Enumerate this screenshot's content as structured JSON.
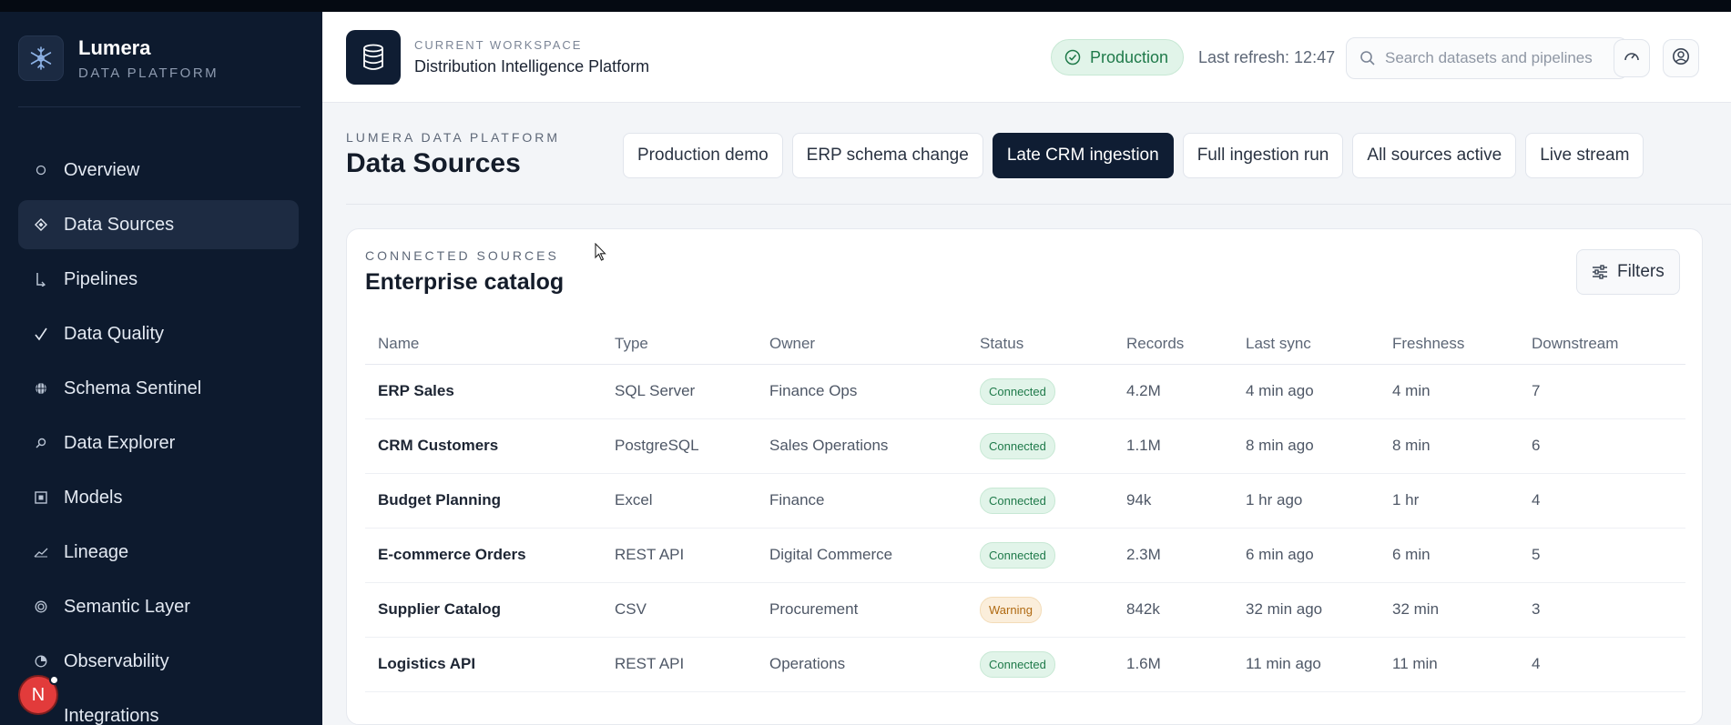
{
  "brand": {
    "name": "Lumera",
    "subtitle": "DATA PLATFORM"
  },
  "sidebar": {
    "items": [
      {
        "label": "Overview",
        "icon": "circle-outline-icon",
        "active": false
      },
      {
        "label": "Data Sources",
        "icon": "diamond-icon",
        "active": true
      },
      {
        "label": "Pipelines",
        "icon": "pipeline-icon",
        "active": false
      },
      {
        "label": "Data Quality",
        "icon": "checkmark-icon",
        "active": false
      },
      {
        "label": "Schema Sentinel",
        "icon": "globe-icon",
        "active": false
      },
      {
        "label": "Data Explorer",
        "icon": "magnifier-icon",
        "active": false
      },
      {
        "label": "Models",
        "icon": "square-icon",
        "active": false
      },
      {
        "label": "Lineage",
        "icon": "lineage-icon",
        "active": false
      },
      {
        "label": "Semantic Layer",
        "icon": "target-icon",
        "active": false
      },
      {
        "label": "Observability",
        "icon": "pie-icon",
        "active": false
      },
      {
        "label": "Integrations",
        "icon": "plug-icon",
        "active": false
      }
    ],
    "avatar_initial": "N"
  },
  "header": {
    "workspace_label": "CURRENT WORKSPACE",
    "workspace_name": "Distribution Intelligence Platform",
    "environment": "Production",
    "last_refresh": "Last refresh: 12:47",
    "search_placeholder": "Search datasets and pipelines"
  },
  "page": {
    "breadcrumb": "LUMERA DATA PLATFORM",
    "title": "Data Sources",
    "scenarios": [
      {
        "label": "Production demo",
        "active": false
      },
      {
        "label": "ERP schema change",
        "active": false
      },
      {
        "label": "Late CRM ingestion",
        "active": true
      },
      {
        "label": "Full ingestion run",
        "active": false
      },
      {
        "label": "All sources active",
        "active": false
      },
      {
        "label": "Live stream",
        "active": false
      }
    ]
  },
  "catalog": {
    "section_label": "CONNECTED SOURCES",
    "title": "Enterprise catalog",
    "filters_label": "Filters",
    "columns": [
      "Name",
      "Type",
      "Owner",
      "Status",
      "Records",
      "Last sync",
      "Freshness",
      "Downstream"
    ],
    "rows": [
      {
        "name": "ERP Sales",
        "type": "SQL Server",
        "owner": "Finance Ops",
        "status": "Connected",
        "records": "4.2M",
        "last_sync": "4 min ago",
        "freshness": "4 min",
        "downstream": "7"
      },
      {
        "name": "CRM Customers",
        "type": "PostgreSQL",
        "owner": "Sales Operations",
        "status": "Connected",
        "records": "1.1M",
        "last_sync": "8 min ago",
        "freshness": "8 min",
        "downstream": "6"
      },
      {
        "name": "Budget Planning",
        "type": "Excel",
        "owner": "Finance",
        "status": "Connected",
        "records": "94k",
        "last_sync": "1 hr ago",
        "freshness": "1 hr",
        "downstream": "4"
      },
      {
        "name": "E-commerce Orders",
        "type": "REST API",
        "owner": "Digital Commerce",
        "status": "Connected",
        "records": "2.3M",
        "last_sync": "6 min ago",
        "freshness": "6 min",
        "downstream": "5"
      },
      {
        "name": "Supplier Catalog",
        "type": "CSV",
        "owner": "Procurement",
        "status": "Warning",
        "records": "842k",
        "last_sync": "32 min ago",
        "freshness": "32 min",
        "downstream": "3"
      },
      {
        "name": "Logistics API",
        "type": "REST API",
        "owner": "Operations",
        "status": "Connected",
        "records": "1.6M",
        "last_sync": "11 min ago",
        "freshness": "11 min",
        "downstream": "4"
      }
    ]
  },
  "colors": {
    "sidebar_bg": "#0d1a2e",
    "accent_dark": "#0f1d33",
    "connected": "#1f7a4a",
    "warning": "#b06a12"
  }
}
